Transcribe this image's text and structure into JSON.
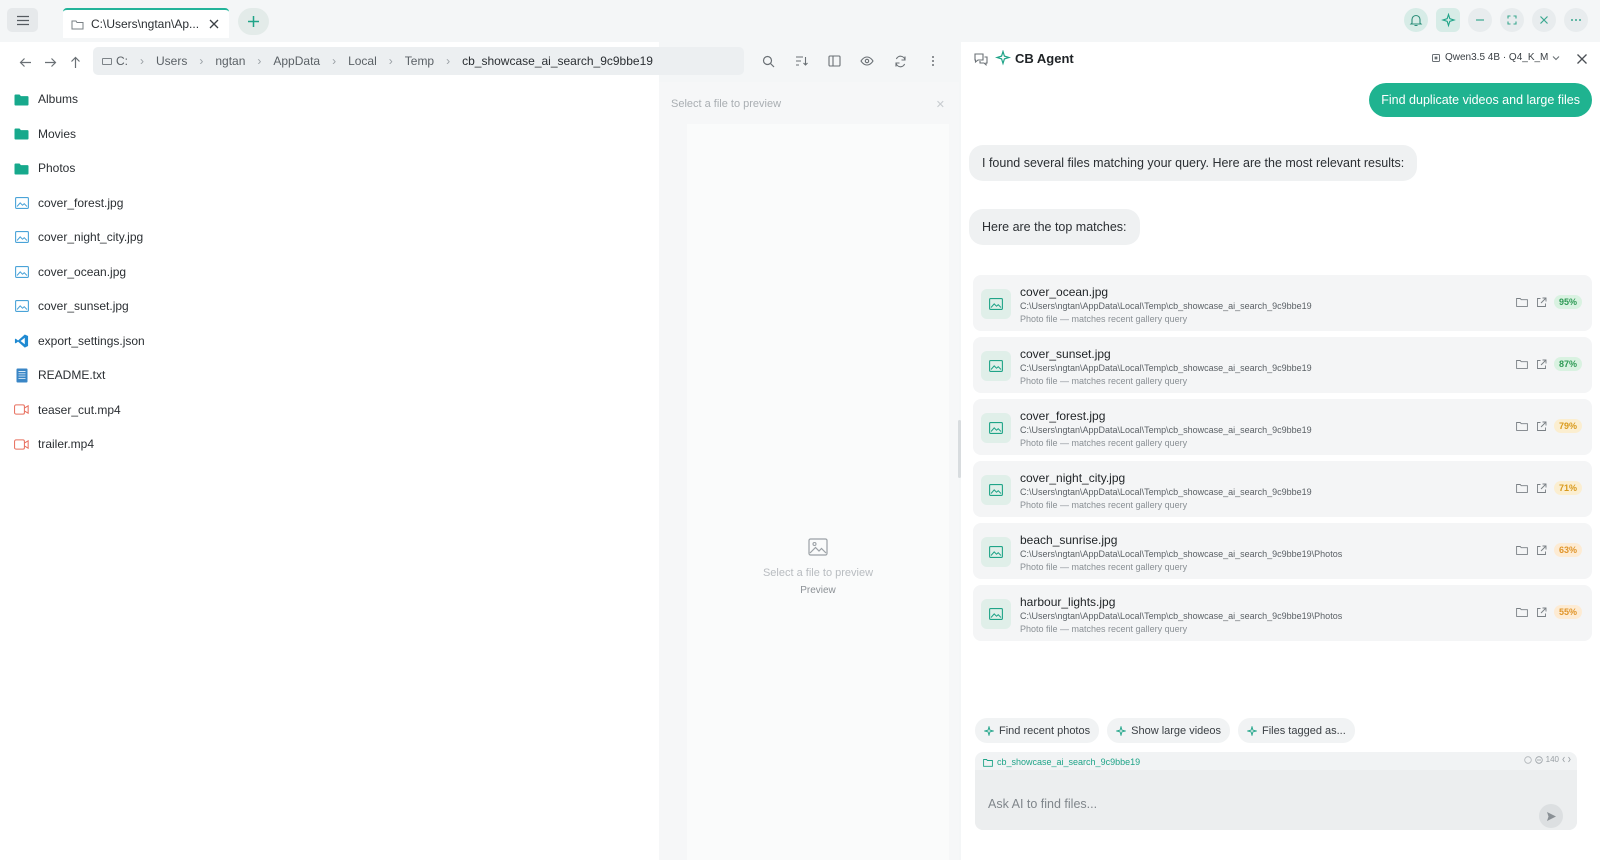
{
  "tab": {
    "label": "C:\\Users\\ngtan\\Ap..."
  },
  "breadcrumb": [
    "C:",
    "Users",
    "ngtan",
    "AppData",
    "Local",
    "Temp",
    "cb_showcase_ai_search_9c9bbe19"
  ],
  "files": [
    {
      "name": "Albums",
      "icon": "folder-icon"
    },
    {
      "name": "Movies",
      "icon": "folder-icon"
    },
    {
      "name": "Photos",
      "icon": "folder-icon"
    },
    {
      "name": "cover_forest.jpg",
      "icon": "image-file-icon"
    },
    {
      "name": "cover_night_city.jpg",
      "icon": "image-file-icon"
    },
    {
      "name": "cover_ocean.jpg",
      "icon": "image-file-icon"
    },
    {
      "name": "cover_sunset.jpg",
      "icon": "image-file-icon"
    },
    {
      "name": "export_settings.json",
      "icon": "vscode-icon"
    },
    {
      "name": "README.txt",
      "icon": "text-file-icon"
    },
    {
      "name": "teaser_cut.mp4",
      "icon": "video-file-icon"
    },
    {
      "name": "trailer.mp4",
      "icon": "video-file-icon"
    }
  ],
  "preview": {
    "header": "Select a file to preview",
    "hint": "Select a file to preview",
    "label": "Preview"
  },
  "agent": {
    "title": "CB Agent",
    "model": "Qwen3.5 4B · Q4_K_M",
    "user_message": "Find duplicate videos and large files",
    "bot_message_1": "I found several files matching your query. Here are the most relevant results:",
    "bot_message_2": "Here are the top matches:",
    "results": [
      {
        "name": "cover_ocean.jpg",
        "path": "C:\\Users\\ngtan\\AppData\\Local\\Temp\\cb_showcase_ai_search_9c9bbe19",
        "desc": "Photo file — matches recent gallery query",
        "score": "95%",
        "score_color": "#2e9a55",
        "score_bg": "#d9f2e1"
      },
      {
        "name": "cover_sunset.jpg",
        "path": "C:\\Users\\ngtan\\AppData\\Local\\Temp\\cb_showcase_ai_search_9c9bbe19",
        "desc": "Photo file — matches recent gallery query",
        "score": "87%",
        "score_color": "#2e9a55",
        "score_bg": "#d9f2e1"
      },
      {
        "name": "cover_forest.jpg",
        "path": "C:\\Users\\ngtan\\AppData\\Local\\Temp\\cb_showcase_ai_search_9c9bbe19",
        "desc": "Photo file — matches recent gallery query",
        "score": "79%",
        "score_color": "#d99a1c",
        "score_bg": "#fbeed0"
      },
      {
        "name": "cover_night_city.jpg",
        "path": "C:\\Users\\ngtan\\AppData\\Local\\Temp\\cb_showcase_ai_search_9c9bbe19",
        "desc": "Photo file — matches recent gallery query",
        "score": "71%",
        "score_color": "#d99a1c",
        "score_bg": "#fbeed0"
      },
      {
        "name": "beach_sunrise.jpg",
        "path": "C:\\Users\\ngtan\\AppData\\Local\\Temp\\cb_showcase_ai_search_9c9bbe19\\Photos",
        "desc": "Photo file — matches recent gallery query",
        "score": "63%",
        "score_color": "#e0952a",
        "score_bg": "#fdebd3"
      },
      {
        "name": "harbour_lights.jpg",
        "path": "C:\\Users\\ngtan\\AppData\\Local\\Temp\\cb_showcase_ai_search_9c9bbe19\\Photos",
        "desc": "Photo file — matches recent gallery query",
        "score": "55%",
        "score_color": "#e0952a",
        "score_bg": "#fdebd3"
      }
    ],
    "suggestions": [
      "Find recent photos",
      "Show large videos",
      "Files tagged as..."
    ],
    "context_folder": "cb_showcase_ai_search_9c9bbe19",
    "token_count": "140",
    "input_placeholder": "Ask AI to find files..."
  },
  "colors": {
    "accent": "#1fb390",
    "folder": "#17a98c",
    "image": "#4aa3d8",
    "video": "#e8705f"
  }
}
